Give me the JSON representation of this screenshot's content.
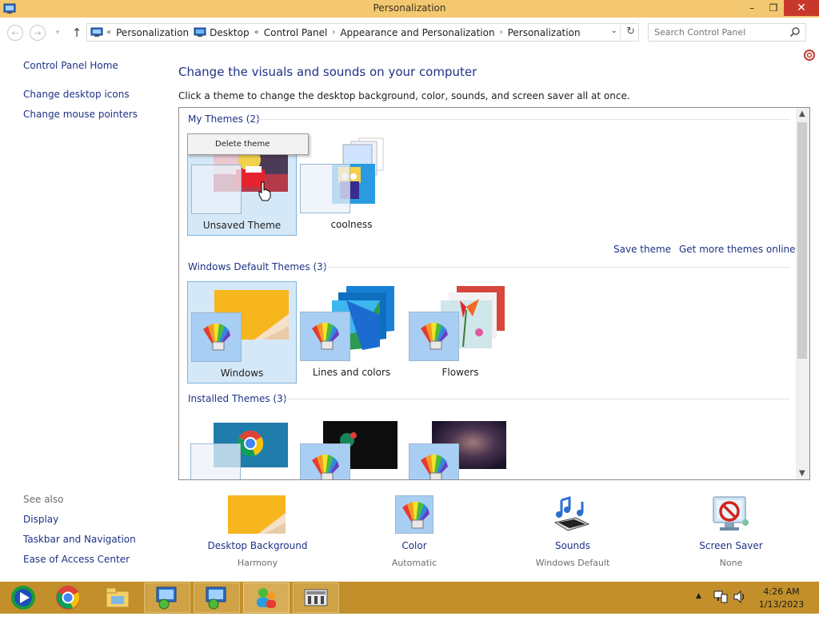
{
  "window": {
    "title": "Personalization",
    "controls": {
      "minimize": "–",
      "maximize": "❐",
      "close": "✕"
    }
  },
  "nav": {
    "back": "←",
    "forward": "→",
    "recent": "▾",
    "up": "↑",
    "address": [
      "Personalization",
      "Desktop",
      "Control Panel",
      "Appearance and Personalization",
      "Personalization"
    ],
    "address_prefix": "«",
    "address_sep_1": "«",
    "address_sep": "›",
    "dropdown": "⌄",
    "refresh": "↻",
    "search_placeholder": "Search Control Panel"
  },
  "left": {
    "home": "Control Panel Home",
    "links": [
      "Change desktop icons",
      "Change mouse pointers"
    ],
    "see_also_heading": "See also",
    "see_also": [
      "Display",
      "Taskbar and Navigation",
      "Ease of Access Center"
    ]
  },
  "main": {
    "title": "Change the visuals and sounds on your computer",
    "subtitle": "Click a theme to change the desktop background, color, sounds, and screen saver all at once.",
    "groups": [
      {
        "heading": "My Themes (2)",
        "themes": [
          "Unsaved Theme",
          "coolness"
        ]
      },
      {
        "heading": "Windows Default Themes (3)",
        "themes": [
          "Windows",
          "Lines and colors",
          "Flowers"
        ]
      },
      {
        "heading": "Installed Themes (3)",
        "themes": [
          "",
          "",
          ""
        ]
      }
    ],
    "save_theme": "Save theme",
    "get_more": "Get more themes online",
    "context_menu": [
      "Delete theme"
    ]
  },
  "bottom": [
    {
      "label": "Desktop Background",
      "value": "Harmony"
    },
    {
      "label": "Color",
      "value": "Automatic"
    },
    {
      "label": "Sounds",
      "value": "Windows Default"
    },
    {
      "label": "Screen Saver",
      "value": "None"
    }
  ],
  "taskbar": {
    "time": "4:26 AM",
    "date": "1/13/2023",
    "tray_arrow": "▲"
  },
  "colors": {
    "titlebar": "#f3c870",
    "taskbar": "#c28f2b",
    "link": "#1e3287",
    "close": "#c7382a",
    "selection": "#d5e8f7"
  }
}
